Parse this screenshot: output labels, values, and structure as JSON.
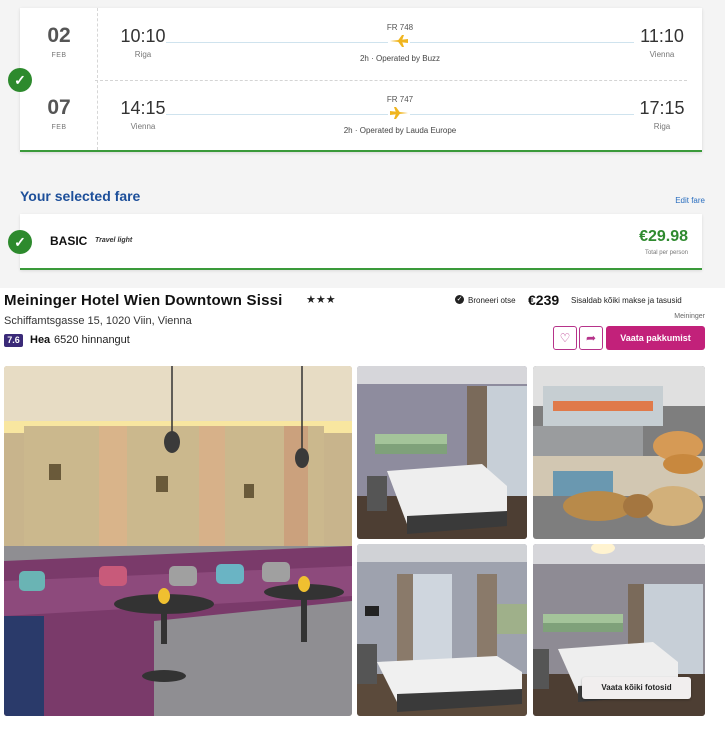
{
  "flights": [
    {
      "day": "02",
      "month": "FEB",
      "dep_time": "10:10",
      "dep_city": "Riga",
      "arr_time": "11:10",
      "arr_city": "Vienna",
      "flight_no": "FR 748",
      "info": "2h · Operated by Buzz"
    },
    {
      "day": "07",
      "month": "FEB",
      "dep_time": "14:15",
      "dep_city": "Vienna",
      "arr_time": "17:15",
      "arr_city": "Riga",
      "flight_no": "FR 747",
      "info": "2h · Operated by Lauda Europe"
    }
  ],
  "fare": {
    "heading": "Your selected fare",
    "edit_label": "Edit fare",
    "name": "BASIC",
    "subtitle": "Travel light",
    "price": "€29.98",
    "price_note": "Total per person"
  },
  "hotel": {
    "name": "Meininger Hotel Wien Downtown Sissi",
    "stars": "★★★",
    "address": "Schiffamtsgasse 15, 1020 Viin, Vienna",
    "rating": "7.6",
    "rating_word": "Hea",
    "rating_count": "6520 hinnangut",
    "book_direct": "Broneeri otse",
    "price": "€239",
    "price_note": "Sisaldab kõiki makse ja tasusid",
    "provider": "Meininger",
    "deal_button": "Vaata pakkumist",
    "all_photos_button": "Vaata kõiki fotosid"
  },
  "colors": {
    "accent_green": "#2f8a2f",
    "fare_heading_blue": "#1d4f9a",
    "deal_magenta": "#c2217a",
    "rating_purple": "#3a2a78"
  },
  "icons": {
    "check": "check-circle-icon",
    "plane": "plane-icon",
    "heart": "heart-icon",
    "share": "share-arrow-icon",
    "verified": "verified-badge-icon"
  }
}
